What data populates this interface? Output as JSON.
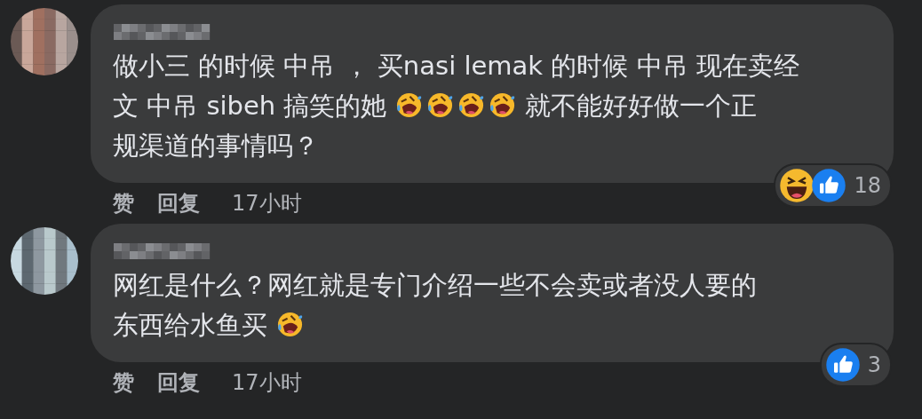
{
  "comments": [
    {
      "lines": [
        [
          {
            "kind": "text",
            "text": "做小三 的时候 中吊 ， 买nasi lemak 的时候 中吊 现在卖经"
          }
        ],
        [
          {
            "kind": "text",
            "text": "文 中吊 sibeh 搞笑的她"
          },
          {
            "kind": "emoji"
          },
          {
            "kind": "emoji"
          },
          {
            "kind": "emoji"
          },
          {
            "kind": "emoji"
          },
          {
            "kind": "text",
            "text": "就不能好好做一个正"
          }
        ],
        [
          {
            "kind": "text",
            "text": "规渠道的事情吗？"
          }
        ]
      ],
      "reactions": {
        "icons": [
          {
            "kind": "haha"
          },
          {
            "kind": "like"
          }
        ],
        "count": "18"
      },
      "actions": {
        "like": "赞",
        "reply": "回复",
        "time": "17小时"
      }
    },
    {
      "lines": [
        [
          {
            "kind": "text",
            "text": "网红是什么？网红就是专门介绍一些不会卖或者没人要的"
          }
        ],
        [
          {
            "kind": "text",
            "text": "东西给水鱼买"
          },
          {
            "kind": "emoji"
          }
        ]
      ],
      "reactions": {
        "icons": [
          {
            "kind": "like"
          }
        ],
        "count": "3"
      },
      "actions": {
        "like": "赞",
        "reply": "回复",
        "time": "17小时"
      }
    }
  ]
}
